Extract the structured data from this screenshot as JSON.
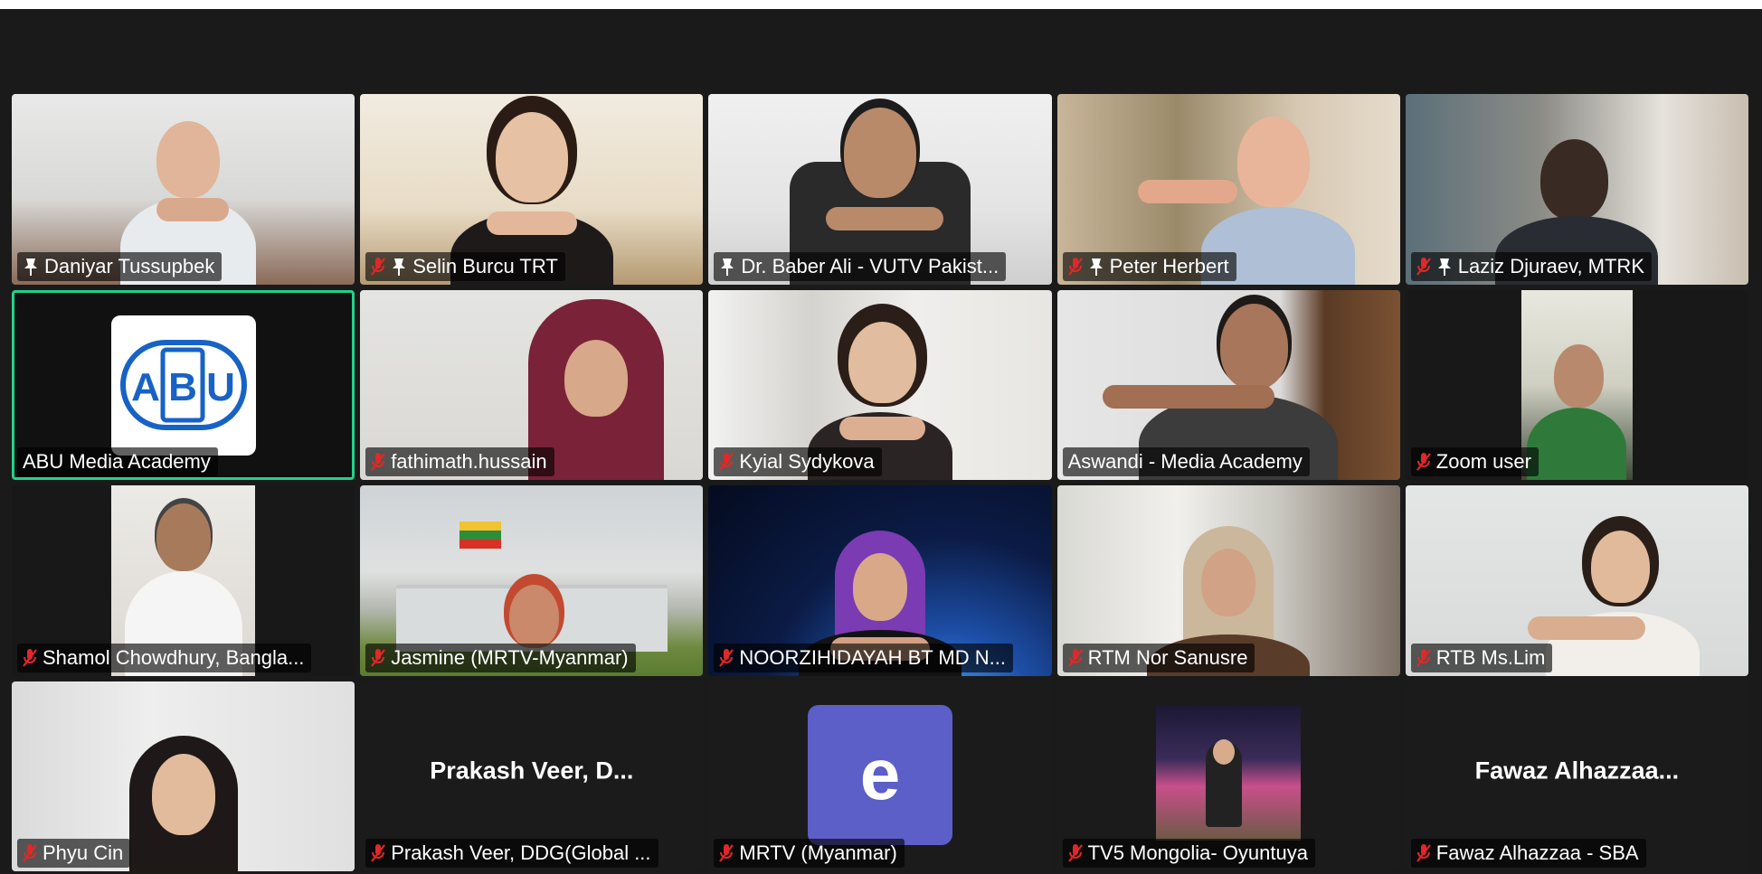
{
  "participants": [
    {
      "name": "Daniyar Tussupbek",
      "muted": false,
      "spotlight": true
    },
    {
      "name": "Selin Burcu TRT",
      "muted": true,
      "spotlight": true
    },
    {
      "name": "Dr. Baber Ali - VUTV Pakist...",
      "muted": false,
      "spotlight": true
    },
    {
      "name": "Peter Herbert",
      "muted": true,
      "spotlight": true
    },
    {
      "name": "Laziz Djuraev, MTRK",
      "muted": true,
      "spotlight": true
    },
    {
      "name": "ABU Media Academy",
      "muted": false,
      "spotlight": false,
      "active_speaker": true,
      "logo_text": "ABU"
    },
    {
      "name": "fathimath.hussain",
      "muted": true,
      "spotlight": false
    },
    {
      "name": "Kyial Sydykova",
      "muted": true,
      "spotlight": false
    },
    {
      "name": "Aswandi - Media Academy",
      "muted": false,
      "spotlight": false
    },
    {
      "name": "Zoom user",
      "muted": true,
      "spotlight": false
    },
    {
      "name": "Shamol Chowdhury, Bangla...",
      "muted": true,
      "spotlight": false
    },
    {
      "name": "Jasmine (MRTV-Myanmar)",
      "muted": true,
      "spotlight": false
    },
    {
      "name": "NOORZIHIDAYAH BT MD N...",
      "muted": true,
      "spotlight": false
    },
    {
      "name": "RTM Nor Sanusre",
      "muted": true,
      "spotlight": false
    },
    {
      "name": "RTB Ms.Lim",
      "muted": true,
      "spotlight": false
    },
    {
      "name": "Phyu Cin",
      "muted": true,
      "spotlight": false
    },
    {
      "name": "Prakash Veer, DDG(Global ...",
      "muted": true,
      "spotlight": false,
      "display_name": "Prakash Veer, D..."
    },
    {
      "name": "MRTV (Myanmar)",
      "muted": true,
      "spotlight": false,
      "avatar_letter": "e"
    },
    {
      "name": "TV5 Mongolia- Oyuntuya",
      "muted": true,
      "spotlight": false
    },
    {
      "name": "Fawaz Alhazzaa - SBA",
      "muted": true,
      "spotlight": false,
      "display_name": "Fawaz  Alhazzaa..."
    }
  ],
  "colors": {
    "active_border": "#23d18b",
    "muted_icon": "#e02828",
    "avatar_bg": "#5b5fc7",
    "abu_blue": "#1763c5"
  }
}
